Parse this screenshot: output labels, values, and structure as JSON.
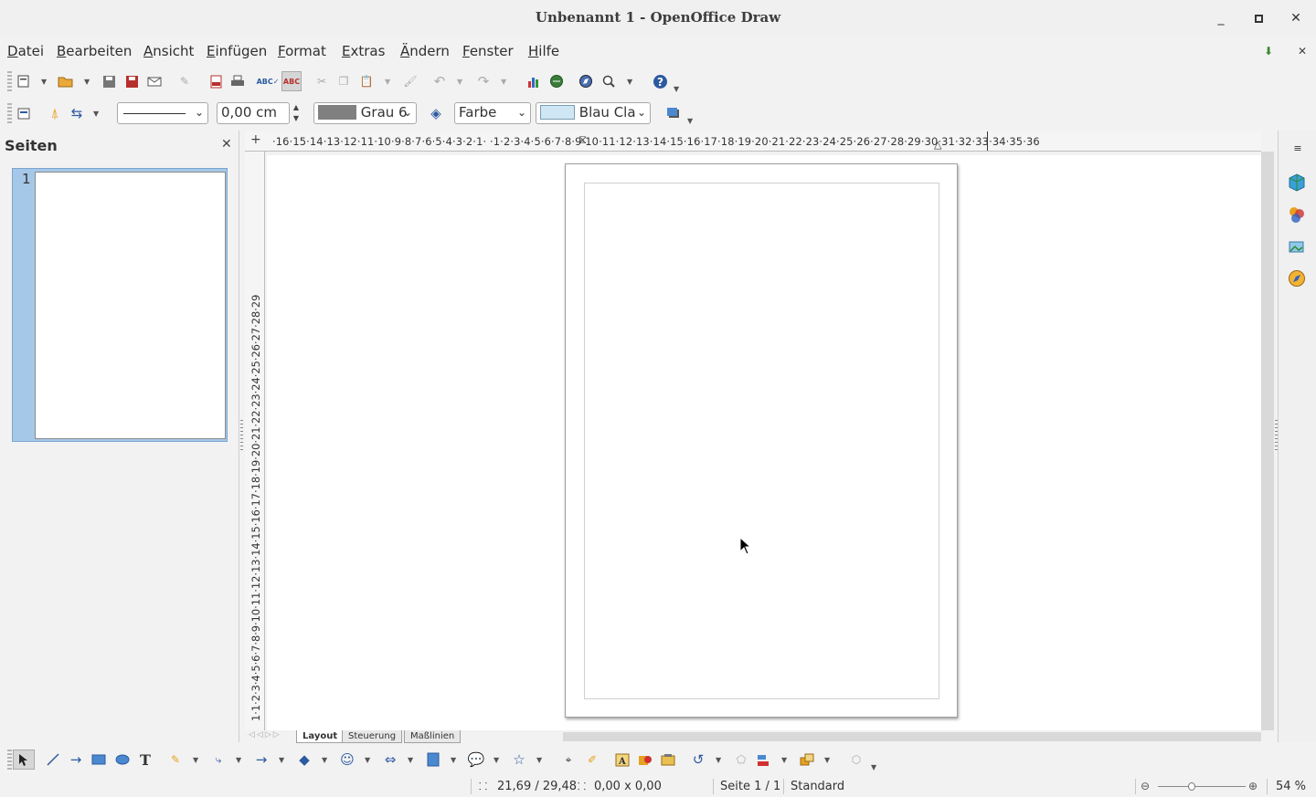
{
  "window": {
    "title": "Unbenannt 1 - OpenOffice Draw"
  },
  "menu": [
    "Datei",
    "Bearbeiten",
    "Ansicht",
    "Einfügen",
    "Format",
    "Extras",
    "Ändern",
    "Fenster",
    "Hilfe"
  ],
  "line_props": {
    "width_value": "0,00 cm",
    "line_color": "Grau 6",
    "area_style": "Farbe",
    "area_color": "Blau Cla"
  },
  "pages_panel": {
    "title": "Seiten",
    "page_number": "1"
  },
  "ruler": {
    "horizontal": "·16·15·14·13·12·11·10·9·8·7·6·5·4·3·2·1·  ·1·2·3·4·5·6·7·8·9·10·11·12·13·14·15·16·17·18·19·20·21·22·23·24·25·26·27·28·29·30·31·32·33·34·35·36",
    "vertical": "1·1·2·3·4·5·6·7·8·9·10·11·12·13·14·15·16·17·18·19·20·21·22·23·24·25·26·27·28·29"
  },
  "layer_tabs": [
    "Layout",
    "Steuerung",
    "Maßlinien"
  ],
  "status": {
    "position": "21,69 / 29,48",
    "size": "0,00 x 0,00",
    "page": "Seite 1 / 1",
    "style": "Standard",
    "zoom": "54 %",
    "zoom_level": 0.54
  },
  "colors": {
    "line_color_swatch": "#808080",
    "area_color_swatch": "#cfe7f5",
    "selection": "#a5c8e8"
  }
}
